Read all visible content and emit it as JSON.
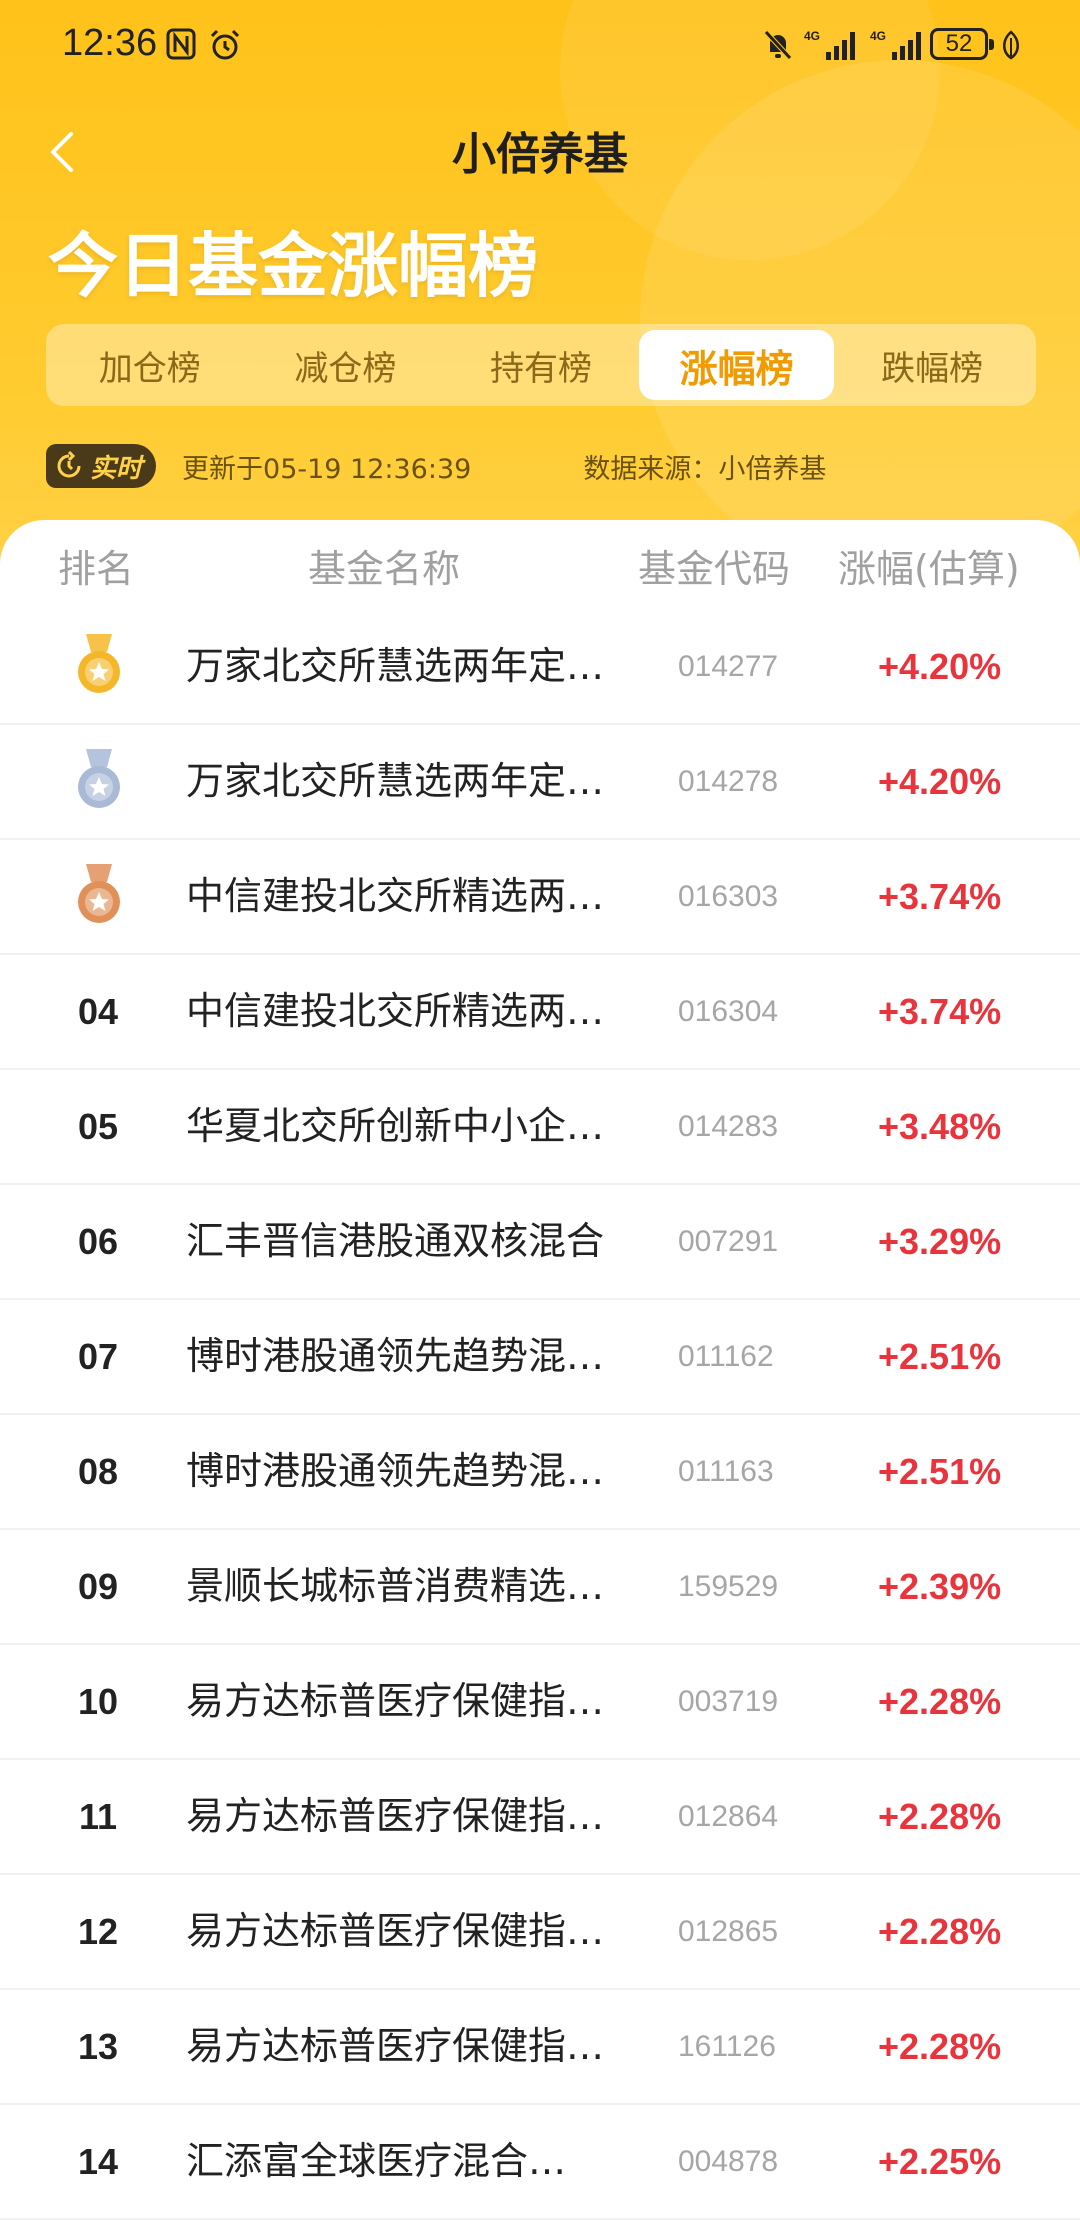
{
  "status_bar": {
    "time": "12:36",
    "battery": "52"
  },
  "header": {
    "app_title": "小倍养基",
    "page_title": "今日基金涨幅榜"
  },
  "tabs": [
    {
      "label": "加仓榜",
      "active": false
    },
    {
      "label": "减仓榜",
      "active": false
    },
    {
      "label": "持有榜",
      "active": false
    },
    {
      "label": "涨幅榜",
      "active": true
    },
    {
      "label": "跌幅榜",
      "active": false
    }
  ],
  "info": {
    "realtime_label": "实时",
    "update_text": "更新于05-19 12:36:39",
    "source_text": "数据来源：小倍养基"
  },
  "table": {
    "headers": {
      "rank": "排名",
      "name": "基金名称",
      "code": "基金代码",
      "change": "涨幅(估算)"
    },
    "rows": [
      {
        "rank": "",
        "medal": "gold",
        "name": "万家北交所慧选两年定…",
        "code": "014277",
        "change": "+4.20%"
      },
      {
        "rank": "",
        "medal": "silver",
        "name": "万家北交所慧选两年定…",
        "code": "014278",
        "change": "+4.20%"
      },
      {
        "rank": "",
        "medal": "bronze",
        "name": "中信建投北交所精选两…",
        "code": "016303",
        "change": "+3.74%"
      },
      {
        "rank": "04",
        "medal": "",
        "name": "中信建投北交所精选两…",
        "code": "016304",
        "change": "+3.74%"
      },
      {
        "rank": "05",
        "medal": "",
        "name": "华夏北交所创新中小企…",
        "code": "014283",
        "change": "+3.48%"
      },
      {
        "rank": "06",
        "medal": "",
        "name": "汇丰晋信港股通双核混合",
        "code": "007291",
        "change": "+3.29%"
      },
      {
        "rank": "07",
        "medal": "",
        "name": "博时港股通领先趋势混…",
        "code": "011162",
        "change": "+2.51%"
      },
      {
        "rank": "08",
        "medal": "",
        "name": "博时港股通领先趋势混…",
        "code": "011163",
        "change": "+2.51%"
      },
      {
        "rank": "09",
        "medal": "",
        "name": "景顺长城标普消费精选…",
        "code": "159529",
        "change": "+2.39%"
      },
      {
        "rank": "10",
        "medal": "",
        "name": "易方达标普医疗保健指…",
        "code": "003719",
        "change": "+2.28%"
      },
      {
        "rank": "11",
        "medal": "",
        "name": "易方达标普医疗保健指…",
        "code": "012864",
        "change": "+2.28%"
      },
      {
        "rank": "12",
        "medal": "",
        "name": "易方达标普医疗保健指…",
        "code": "012865",
        "change": "+2.28%"
      },
      {
        "rank": "13",
        "medal": "",
        "name": "易方达标普医疗保健指…",
        "code": "161126",
        "change": "+2.28%"
      },
      {
        "rank": "14",
        "medal": "",
        "name": "汇添富全球医疗混合…",
        "code": "004878",
        "change": "+2.25%"
      }
    ]
  },
  "colors": {
    "header_yellow": "#FFC21A",
    "accent_orange": "#F29B00",
    "up_red": "#E8343C",
    "gold": "#F5B72A",
    "silver": "#A9B9D6",
    "bronze": "#E0915A"
  }
}
